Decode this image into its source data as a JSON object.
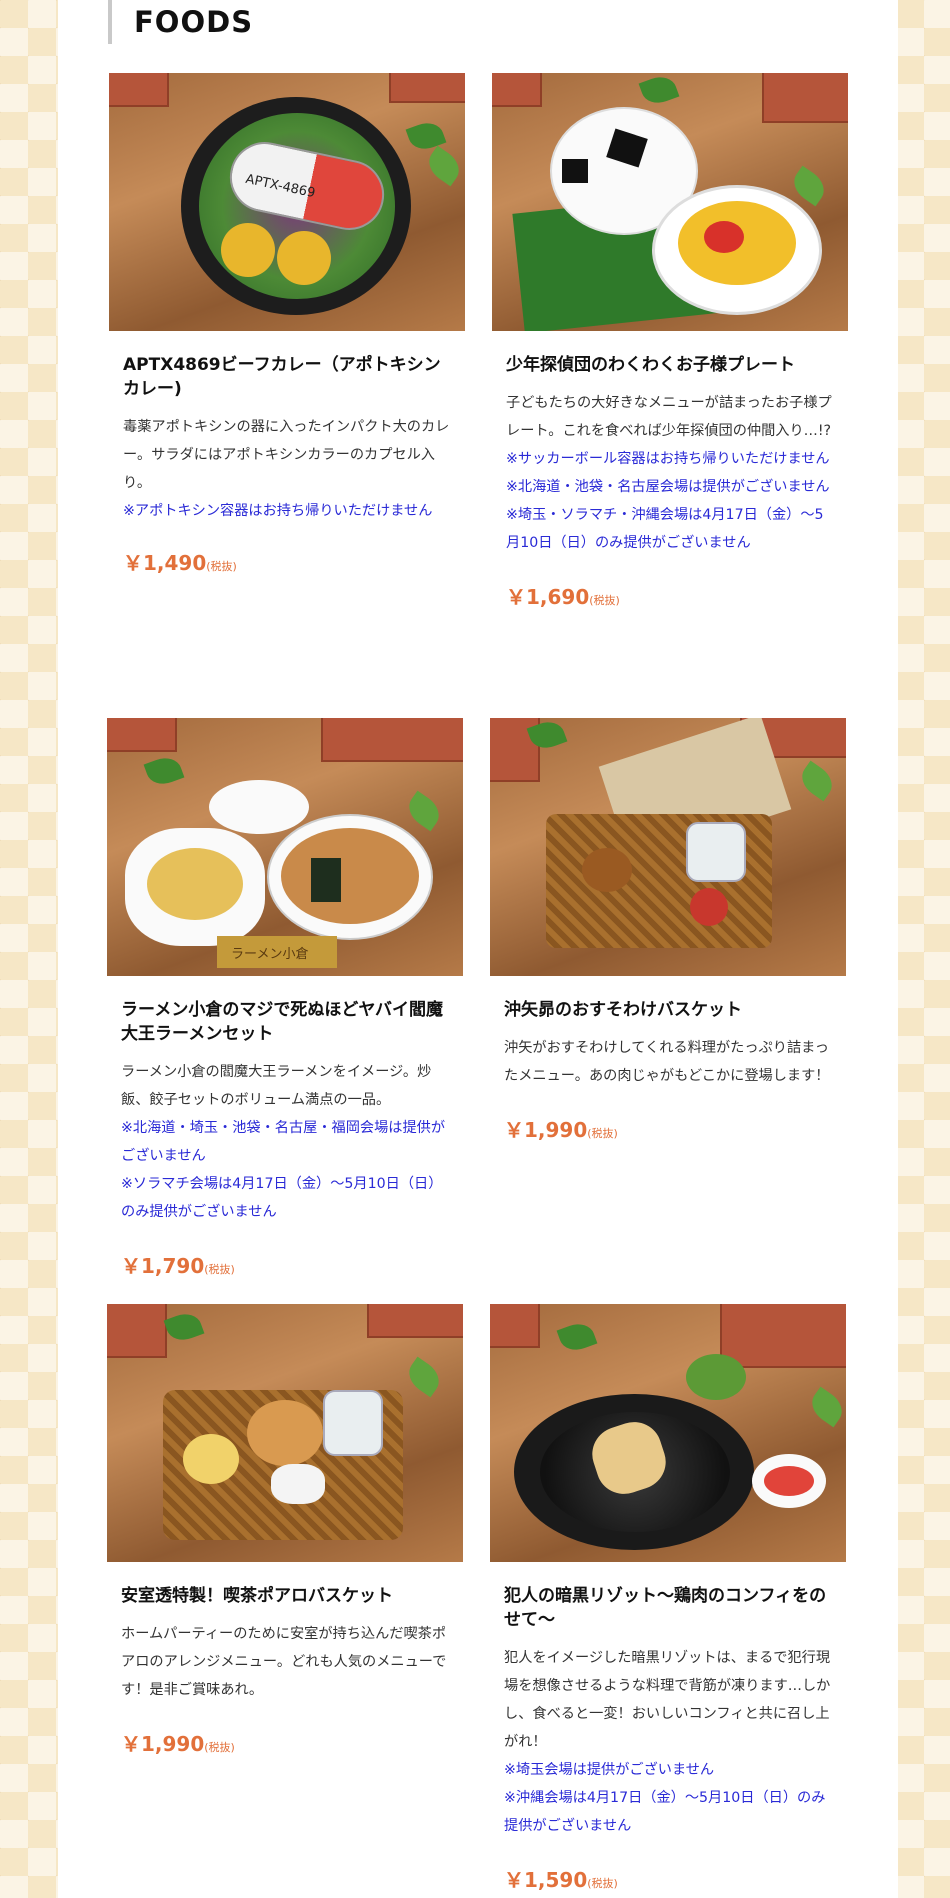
{
  "section": {
    "title": "FOODS"
  },
  "items": [
    {
      "title": "APTX4869ビーフカレー（アポトキシンカレー)",
      "desc": "毒薬アポトキシンの器に入ったインパクト大のカレー。サラダにはアポトキシンカラーのカプセル入り。",
      "notes": [
        "※アポトキシン容器はお持ち帰りいただけません"
      ],
      "price": "￥1,490",
      "tax": "(税抜)",
      "photo_label": "APTX-4869"
    },
    {
      "title": "少年探偵団のわくわくお子様プレート",
      "desc": "子どもたちの大好きなメニューが詰まったお子様プレート。これを食べれば少年探偵団の仲間入り…!?",
      "notes": [
        "※サッカーボール容器はお持ち帰りいただけません",
        "※北海道・池袋・名古屋会場は提供がございません",
        "※埼玉・ソラマチ・沖縄会場は4月17日（金）〜5月10日（日）のみ提供がございません"
      ],
      "price": "￥1,690",
      "tax": "(税抜)",
      "photo_label": ""
    },
    {
      "title": "ラーメン小倉のマジで死ぬほどヤバイ閻魔大王ラーメンセット",
      "desc": "ラーメン小倉の閻魔大王ラーメンをイメージ。炒飯、餃子セットのボリューム満点の一品。",
      "notes": [
        "※北海道・埼玉・池袋・名古屋・福岡会場は提供がございません",
        "※ソラマチ会場は4月17日（金）〜5月10日（日）のみ提供がございません"
      ],
      "price": "￥1,790",
      "tax": "(税抜)",
      "photo_label": "ラーメン小倉"
    },
    {
      "title": "沖矢昴のおすそわけバスケット",
      "desc": "沖矢がおすそわけしてくれる料理がたっぷり詰まったメニュー。あの肉じゃがもどこかに登場します！",
      "notes": [],
      "price": "￥1,990",
      "tax": "(税抜)",
      "photo_label": ""
    },
    {
      "title": "安室透特製！喫茶ポアロバスケット",
      "desc": "ホームパーティーのために安室が持ち込んだ喫茶ポアロのアレンジメニュー。どれも人気のメニューです！是非ご賞味あれ。",
      "notes": [],
      "price": "￥1,990",
      "tax": "(税抜)",
      "photo_label": ""
    },
    {
      "title": "犯人の暗黒リゾット〜鶏肉のコンフィをのせて〜",
      "desc": "犯人をイメージした暗黒リゾットは、まるで犯行現場を想像させるような料理で背筋が凍ります…しかし、食べると一変！おいしいコンフィと共に召し上がれ！",
      "notes": [
        "※埼玉会場は提供がございません",
        "※沖縄会場は4月17日（金）〜5月10日（日）のみ提供がございません"
      ],
      "price": "￥1,590",
      "tax": "(税抜)",
      "photo_label": ""
    }
  ]
}
